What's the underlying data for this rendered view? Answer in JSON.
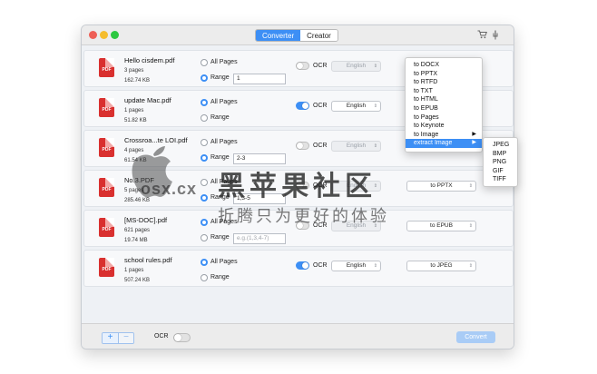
{
  "window": {
    "tabs": [
      {
        "label": "Converter",
        "active": true
      },
      {
        "label": "Creator",
        "active": false
      }
    ],
    "cart_icon": "cart-icon",
    "pin_icon": "pin-icon"
  },
  "range_opts": {
    "all_pages": "All Pages",
    "range": "Range"
  },
  "ocr_label": "OCR",
  "files": [
    {
      "name": "Hello cisdem.pdf",
      "pages": "3 pages",
      "size": "162.74 KB",
      "mode": "range",
      "range_value": "1",
      "range_placeholder": "",
      "ocr_on": false,
      "language": "English",
      "format": ""
    },
    {
      "name": "update Mac.pdf",
      "pages": "1 pages",
      "size": "51.82 KB",
      "mode": "all",
      "range_value": "",
      "range_placeholder": "",
      "ocr_on": true,
      "language": "English",
      "format": ""
    },
    {
      "name": "Crossroa...te LOI.pdf",
      "pages": "4 pages",
      "size": "61.54 KB",
      "mode": "range",
      "range_value": "2-3",
      "range_placeholder": "",
      "ocr_on": false,
      "language": "English",
      "format": ""
    },
    {
      "name": "No.3.PDF",
      "pages": "5 pages",
      "size": "285.46 KB",
      "mode": "range",
      "range_value": "1,3-5",
      "range_placeholder": "",
      "ocr_on": false,
      "language": "English",
      "format": "to PPTX"
    },
    {
      "name": "[MS-DOC].pdf",
      "pages": "621 pages",
      "size": "19.74 MB",
      "mode": "all",
      "range_value": "",
      "range_placeholder": "e.g.(1,3,4-7)",
      "ocr_on": false,
      "language": "English",
      "format": "to EPUB"
    },
    {
      "name": "school rules.pdf",
      "pages": "1 pages",
      "size": "507.24 KB",
      "mode": "all",
      "range_value": "",
      "range_placeholder": "",
      "ocr_on": true,
      "language": "English",
      "format": "to JPEG"
    }
  ],
  "pdf_badge": "PDF",
  "format_menu": [
    "to DOCX",
    "to PPTX",
    "to RTFD",
    "to TXT",
    "to HTML",
    "to EPUB",
    "to Pages",
    "to Keynote",
    "to Image",
    "extract Image"
  ],
  "format_menu_highlight": "extract Image",
  "image_submenu": [
    "JPEG",
    "BMP",
    "PNG",
    "GIF",
    "TIFF"
  ],
  "bottom": {
    "add": "+",
    "remove": "−",
    "ocr_label": "OCR",
    "convert": "Convert"
  },
  "watermark": {
    "title": "黑苹果社区",
    "site": "osx.cx",
    "slogan": "折腾只为更好的体验"
  }
}
